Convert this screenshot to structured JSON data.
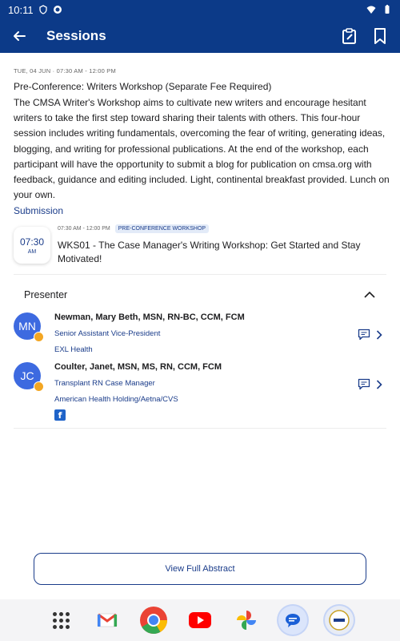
{
  "status_bar": {
    "time": "10:11"
  },
  "app_bar": {
    "title": "Sessions"
  },
  "session": {
    "date_line": "TUE, 04 JUN · 07:30 AM - 12:00 PM",
    "title": "Pre-Conference: Writers Workshop (Separate Fee Required)",
    "description": "The CMSA Writer's Workshop aims to cultivate new writers and encourage hesitant writers to take the first step toward sharing their talents with others. This four-hour session includes writing fundamentals, overcoming the fear of writing, generating ideas, blogging, and writing for professional publications. At the end of the workshop, each participant will have the opportunity to submit a blog for publication on cmsa.org with feedback, guidance and editing included. Light, continental breakfast provided. Lunch on your own."
  },
  "submission": {
    "section_label": "Submission",
    "badge_time": "07:30",
    "badge_ampm": "AM",
    "time_range": "07:30 AM - 12:00 PM",
    "tag": "PRE-CONFERENCE WORKSHOP",
    "title": "WKS01 - The Case Manager's Writing Workshop: Get Started and Stay Motivated!"
  },
  "presenters": {
    "section_label": "Presenter",
    "items": [
      {
        "initials": "MN",
        "name": "Newman, Mary Beth, MSN, RN-BC, CCM, FCM",
        "role": "Senior Assistant Vice-President",
        "org": "EXL Health"
      },
      {
        "initials": "JC",
        "name": "Coulter, Janet, MSN, MS, RN, CCM, FCM",
        "role": "Transplant RN Case Manager",
        "org": "American Health Holding/Aetna/CVS"
      }
    ]
  },
  "actions": {
    "view_abstract": "View Full Abstract"
  },
  "colors": {
    "primary": "#0c3a88",
    "accent": "#1a3c8a",
    "avatar": "#3d6ae0",
    "badge": "#f3a623"
  },
  "dock": [
    "apps-grid-icon",
    "gmail-icon",
    "chrome-icon",
    "youtube-icon",
    "photos-icon",
    "messages-icon",
    "cmsa-icon"
  ]
}
